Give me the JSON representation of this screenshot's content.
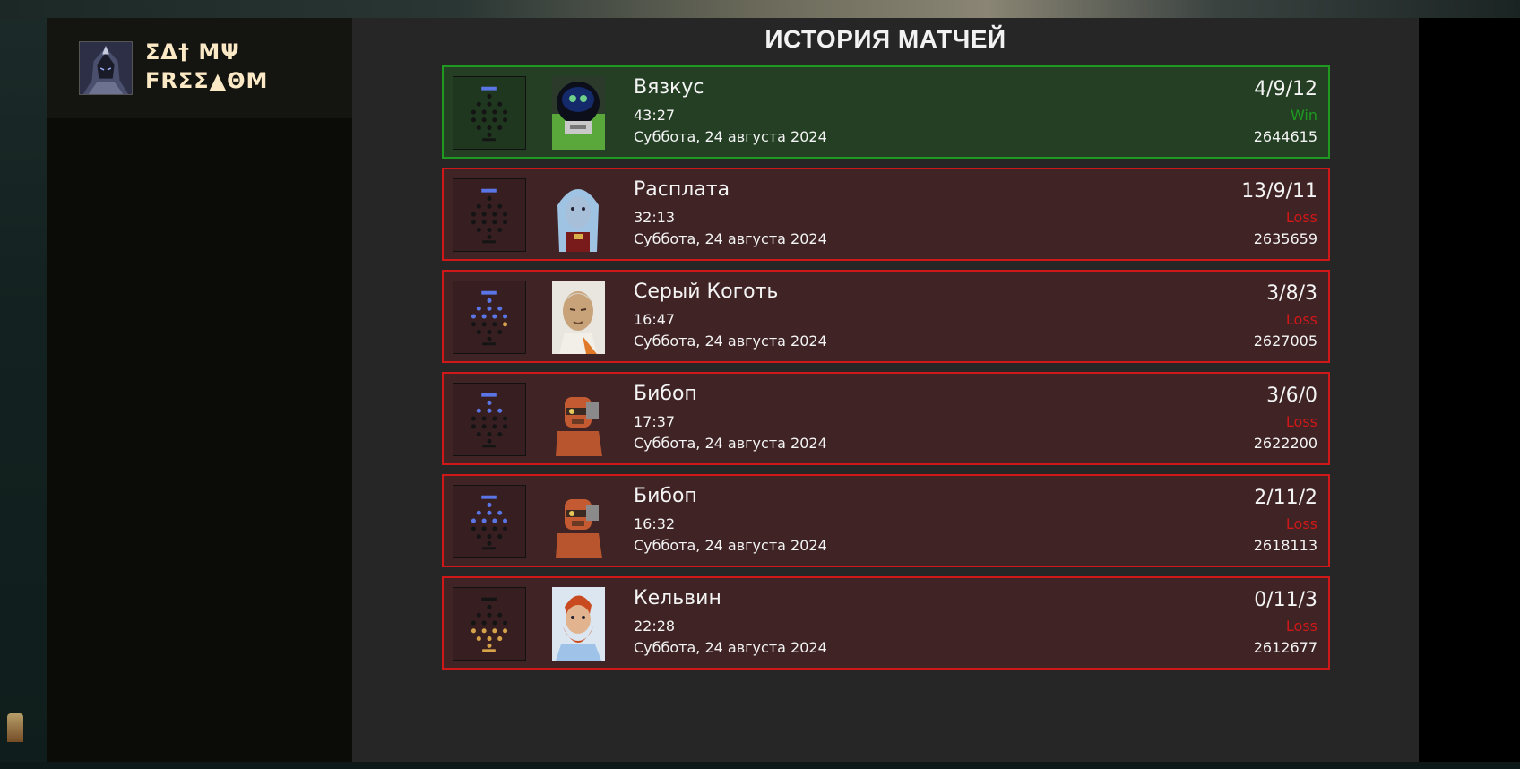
{
  "player": {
    "name_line1": "ΣΔ† ΜΨ",
    "name_line2": "FRΣΣ▲ΘM",
    "avatar_icon": "player-avatar"
  },
  "page": {
    "title": "ИСТОРИЯ МАТЧЕЙ"
  },
  "colors": {
    "win": "#1f9a1f",
    "loss": "#d01818",
    "win_bg": "#243f24",
    "loss_bg": "#3f2325",
    "build_blue": "#5a76e6",
    "build_gold": "#d6a24a"
  },
  "matches": [
    {
      "hero": "Вязкус",
      "duration": "43:27",
      "date": "Суббота, 24 августа 2024",
      "kda": "4/9/12",
      "result": "Win",
      "match_id": "2644615",
      "outcome": "win",
      "portrait_icon": "viscous-portrait",
      "build_icon": "build-tree-icon"
    },
    {
      "hero": "Расплата",
      "duration": "32:13",
      "date": "Суббота, 24 августа 2024",
      "kda": "13/9/11",
      "result": "Loss",
      "match_id": "2635659",
      "outcome": "loss",
      "portrait_icon": "lady-geist-portrait",
      "build_icon": "build-tree-icon"
    },
    {
      "hero": "Серый Коготь",
      "duration": "16:47",
      "date": "Суббота, 24 августа 2024",
      "kda": "3/8/3",
      "result": "Loss",
      "match_id": "2627005",
      "outcome": "loss",
      "portrait_icon": "grey-talon-portrait",
      "build_icon": "build-tree-icon"
    },
    {
      "hero": "Бибоп",
      "duration": "17:37",
      "date": "Суббота, 24 августа 2024",
      "kda": "3/6/0",
      "result": "Loss",
      "match_id": "2622200",
      "outcome": "loss",
      "portrait_icon": "bebop-portrait",
      "build_icon": "build-tree-icon"
    },
    {
      "hero": "Бибоп",
      "duration": "16:32",
      "date": "Суббота, 24 августа 2024",
      "kda": "2/11/2",
      "result": "Loss",
      "match_id": "2618113",
      "outcome": "loss",
      "portrait_icon": "bebop-portrait",
      "build_icon": "build-tree-icon"
    },
    {
      "hero": "Кельвин",
      "duration": "22:28",
      "date": "Суббота, 24 августа 2024",
      "kda": "0/11/3",
      "result": "Loss",
      "match_id": "2612677",
      "outcome": "loss",
      "portrait_icon": "kelvin-portrait",
      "build_icon": "build-tree-icon"
    }
  ]
}
